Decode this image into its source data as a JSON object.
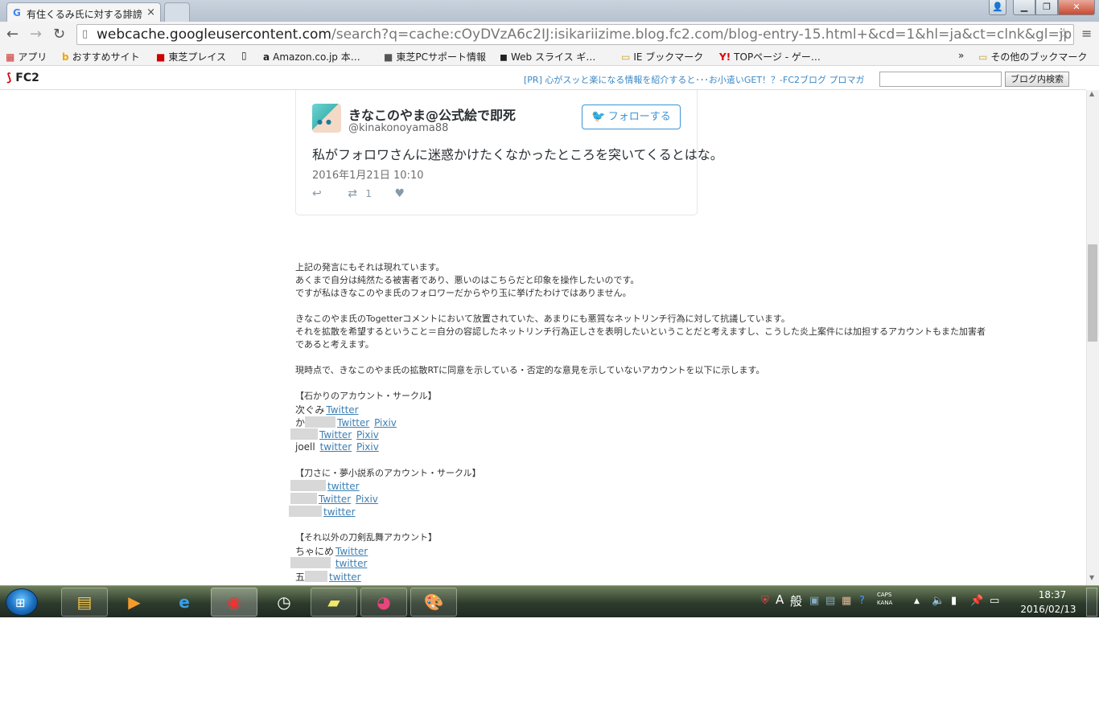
{
  "browser": {
    "tab_title": "有住くるみ氏に対する誹謗",
    "tab_close": "×",
    "url_host": "webcache.googleusercontent.com",
    "url_path": "/search?q=cache:cOyDVzA6c2IJ:isikariizime.blog.fc2.com/blog-entry-15.html+&cd=1&hl=ja&ct=clnk&gl=jp"
  },
  "bookmarks": [
    {
      "label": "アプリ",
      "icon": "apps-icon"
    },
    {
      "label": "おすすめサイト",
      "icon": "bing-icon"
    },
    {
      "label": "東芝プレイス",
      "icon": "toshiba-icon"
    },
    {
      "label": "",
      "icon": "page-icon"
    },
    {
      "label": "Amazon.co.jp 本…",
      "icon": "amazon-icon"
    },
    {
      "label": "東芝PCサポート情報",
      "icon": "toshiba-icon"
    },
    {
      "label": "Web スライス ギ…",
      "icon": "webslice-icon"
    },
    {
      "label": "IE ブックマーク",
      "icon": "folder-icon"
    },
    {
      "label": "TOPページ - ゲー…",
      "icon": "yahoo-icon"
    },
    {
      "label": "»",
      "icon": "more-icon"
    },
    {
      "label": "その他のブックマーク",
      "icon": "folder-icon"
    }
  ],
  "fc2": {
    "logo": "FC2",
    "pr_text": "[PR] 心がスッと楽になる情報を紹介すると･･･お小遣いGET！？-FC2ブログ プロマガ",
    "search_button": "ブログ内検索"
  },
  "tweet": {
    "name": "きなこのやま@公式絵で即死",
    "handle": "@kinakonoyama88",
    "follow": "フォローする",
    "text": "私がフォロワさんに迷惑かけたくなかったところを突いてくるとはな。",
    "date": "2016年1月21日 10:10",
    "retweets": "1"
  },
  "article": {
    "p1": [
      "上記の発言にもそれは現れています。",
      "あくまで自分は純然たる被害者であり、悪いのはこちらだと印象を操作したいのです。",
      "ですが私はきなこのやま氏のフォロワーだからやり玉に挙げたわけではありません。"
    ],
    "p2": [
      "きなこのやま氏のTogetterコメントにおいて放置されていた、あまりにも悪質なネットリンチ行為に対して抗議しています。",
      "それを拡散を希望するということ＝自分の容認したネットリンチ行為正しさを表明したいということだと考えますし、こうした炎上案件には加担するアカウントもまた加害者",
      "であると考えます。"
    ],
    "p3": "現時点で、きなこのやま氏の拡散RTに同意を示している・否定的な意見を示していないアカウントを以下に示します。",
    "group1_title": "【石かりのアカウント・サークル】",
    "group1": [
      {
        "name": "次ぐみ",
        "links": [
          "Twitter"
        ]
      },
      {
        "name": "か",
        "links": [
          "Twitter",
          "Pixiv"
        ]
      },
      {
        "name": "",
        "links": [
          "Twitter",
          "Pixiv"
        ]
      },
      {
        "name": "joell",
        "links": [
          "twitter",
          "Pixiv"
        ]
      }
    ],
    "group2_title": "【刀さに・夢小説系のアカウント・サークル】",
    "group2": [
      {
        "name": "",
        "links": [
          "twitter"
        ]
      },
      {
        "name": "",
        "links": [
          "Twitter",
          "Pixiv"
        ]
      },
      {
        "name": "",
        "links": [
          "twitter"
        ]
      }
    ],
    "group3_title": "【それ以外の刀剣乱舞アカウント】",
    "group3": [
      {
        "name": "ちゃにめ",
        "links": [
          "Twitter"
        ]
      },
      {
        "name": "",
        "links": [
          "twitter"
        ]
      },
      {
        "name": "五",
        "links": [
          "twitter"
        ]
      }
    ]
  },
  "taskbar": {
    "time": "18:37",
    "date": "2016/02/13",
    "ime_a": "A",
    "ime_mode": "般",
    "caps": "CAPS",
    "kana": "KANA"
  }
}
